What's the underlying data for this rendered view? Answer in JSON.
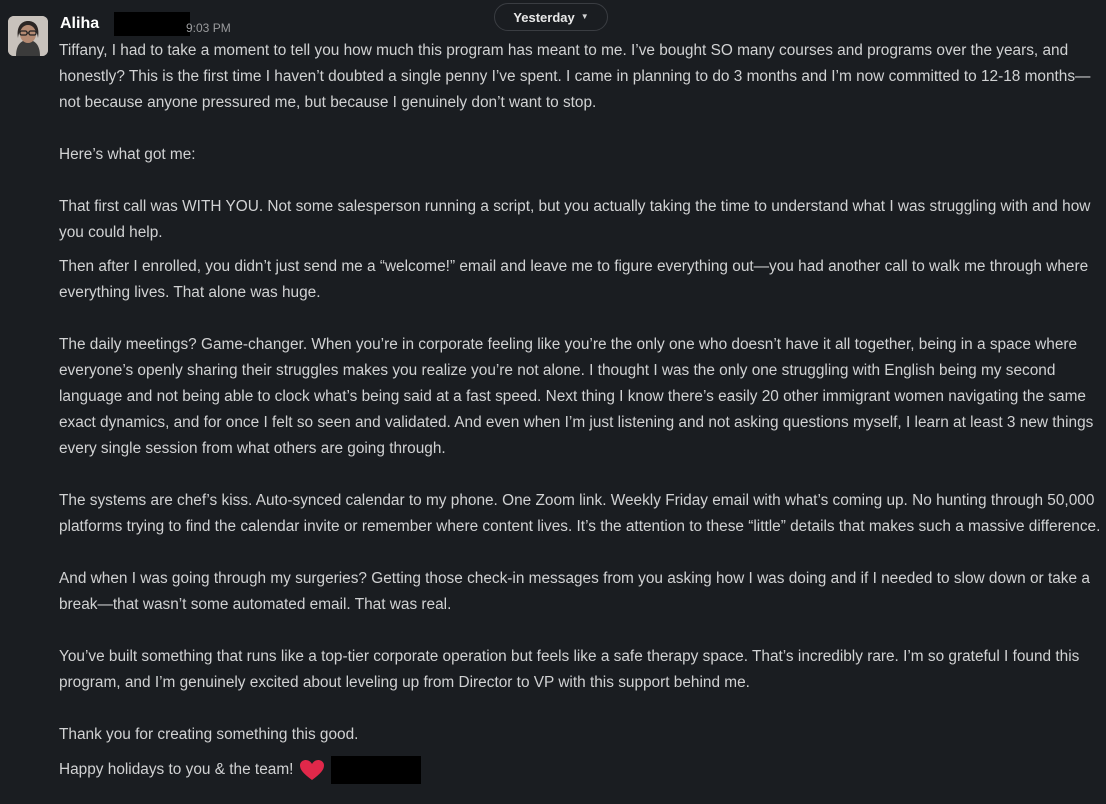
{
  "message": {
    "sender": "Aliha",
    "timestamp": "9:03 PM",
    "date_divider": "Yesterday",
    "date_divider_icon": "chevron-down-icon",
    "avatar_icon": "user-avatar",
    "paragraphs": [
      "Tiffany, I had to take a moment to tell you how much this program has meant to me. I’ve bought SO many courses and programs over the years, and honestly? This is the first time I haven’t doubted a single penny I’ve spent. I came in planning to do 3 months and I’m now committed to 12-18 months—not because anyone pressured me, but because I genuinely don’t want to stop.",
      "Here’s what got me:",
      "That first call was WITH YOU. Not some salesperson running a script, but you actually taking the time to understand what I was struggling with and how you could help.",
      "Then after I enrolled, you didn’t just send me a “welcome!” email and leave me to figure everything out—you had another call to walk me through where everything lives. That alone was huge.",
      "The daily meetings? Game-changer. When you’re in corporate feeling like you’re the only one who doesn’t have it all together, being in a space where everyone’s openly sharing their struggles makes you realize you’re not alone. I thought I was the only one struggling with English being my second language and not being able to clock what’s being said at a fast speed. Next thing I know there’s easily 20 other immigrant women navigating the same exact dynamics, and for once I felt so seen and validated. And even when I’m just listening and not asking questions myself, I learn at least 3 new things every single session from what others are going through.",
      "The systems are chef’s kiss. Auto-synced calendar to my phone. One Zoom link. Weekly Friday email with what’s coming up. No hunting through 50,000 platforms trying to find the calendar invite or remember where content lives. It’s the attention to these “little” details that makes such a massive difference.",
      "And when I was going through my surgeries? Getting those check-in messages from you asking how I was doing and if I needed to slow down or take a break—that wasn’t some automated email. That was real.",
      "You’ve built something that runs like a top-tier corporate operation but feels like a safe therapy space. That’s incredibly rare. I’m so grateful I found this program, and I’m genuinely excited about leveling up from Director to VP with this support behind me.",
      "Thank you for creating something this good.",
      "Happy holidays to you & the team!"
    ],
    "closing_emoji": "red-heart-emoji",
    "heart_color": "#e0284a"
  }
}
